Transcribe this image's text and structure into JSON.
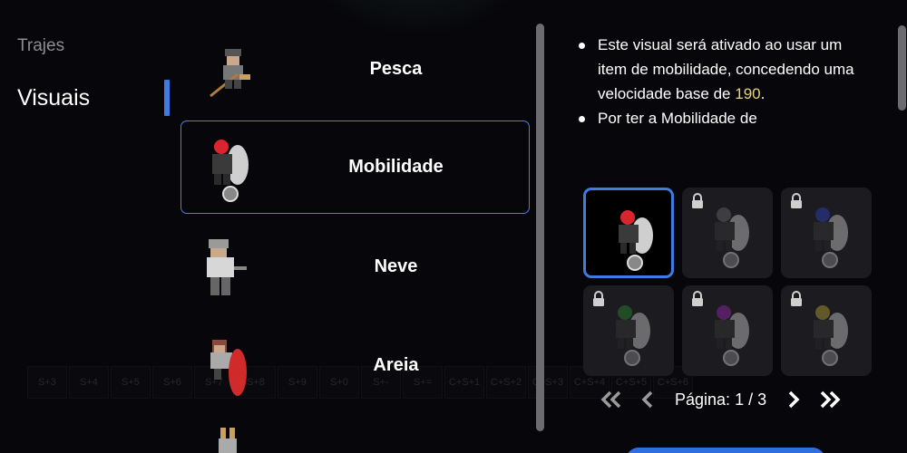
{
  "nav": {
    "trajes": "Trajes",
    "visuais": "Visuais"
  },
  "visual_list": [
    {
      "name": "Pesca",
      "icon": "fishing-character-sprite"
    },
    {
      "name": "Mobilidade",
      "icon": "mobility-character-sprite"
    },
    {
      "name": "Neve",
      "icon": "snow-character-sprite"
    },
    {
      "name": "Areia",
      "icon": "sand-character-sprite"
    }
  ],
  "description": {
    "line1_a": "Este visual será ativado ao usar um item de mobilidade, concedendo uma velocidade base de ",
    "line1_value": "190",
    "line1_b": ".",
    "line2": "Por ter a Mobilidade de"
  },
  "skins": [
    {
      "variant": "red",
      "locked": false,
      "color": "#d9262e"
    },
    {
      "variant": "gray",
      "locked": true,
      "color": "#6a6a6a"
    },
    {
      "variant": "blue",
      "locked": true,
      "color": "#3346c4"
    },
    {
      "variant": "green",
      "locked": true,
      "color": "#2c8a2c"
    },
    {
      "variant": "purple",
      "locked": true,
      "color": "#9a2ab3"
    },
    {
      "variant": "yellow",
      "locked": true,
      "color": "#b9a833"
    }
  ],
  "pager": {
    "label": "Página:",
    "current": "1",
    "separator": "/",
    "total": "3"
  },
  "hotbar": [
    "S+3",
    "S+4",
    "S+5",
    "S+6",
    "S+7",
    "S+8",
    "S+9",
    "S+0",
    "S+-",
    "S+=",
    "C+S+1",
    "C+S+2",
    "C+S+3",
    "C+S+4",
    "C+S+5",
    "C+S+6"
  ],
  "colors": {
    "accent": "#3f7be0",
    "highlight_value": "#e6d27a",
    "panel_bg": "#07070b"
  }
}
